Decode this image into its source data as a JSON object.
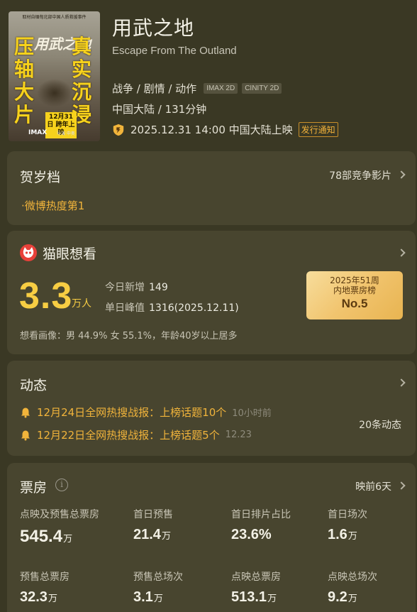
{
  "movie": {
    "title": "用武之地",
    "subtitle": "Escape From The Outland",
    "genres": "战争 / 剧情 / 动作",
    "tags": [
      "IMAX 2D",
      "CINITY 2D"
    ],
    "region_duration": "中国大陆 / 131分钟",
    "release": "2025.12.31 14:00 中国大陆上映",
    "notify_label": "发行通知",
    "poster": {
      "top_text": "取材自缅甸北部中国人质救援事件",
      "logo": "用武之地",
      "left_text": "压轴大片",
      "right_text": "真实沉浸",
      "date_text": "12月31日 跨年上映",
      "imax": "IMAX",
      "credit": "导演 申奥"
    }
  },
  "holiday": {
    "title": "贺岁档",
    "competitors": "78部竞争影片",
    "rank": "·微博热度第1"
  },
  "maoyan": {
    "title": "猫眼想看",
    "count": "3.3",
    "unit": "万人",
    "today_label": "今日新增",
    "today_value": "149",
    "peak_label": "单日峰值",
    "peak_value": "1316(2025.12.11)",
    "badge_line1": "2025年51周",
    "badge_line2": "内地票房榜",
    "badge_rank": "No.5",
    "portrait": "想看画像：男 44.9%  女 55.1%，年龄40岁以上居多"
  },
  "dynamics": {
    "title": "动态",
    "items": [
      {
        "text": "12月24日全网热搜战报：上榜话题10个",
        "time": "10小时前"
      },
      {
        "text": "12月22日全网热搜战报：上榜话题5个",
        "time": "12.23"
      }
    ],
    "count": "20条动态"
  },
  "boxoffice": {
    "title": "票房",
    "days_before": "映前6天",
    "stats": [
      {
        "label": "点映及预售总票房",
        "value": "545.4",
        "unit": "万"
      },
      {
        "label": "首日预售",
        "value": "21.4",
        "unit": "万"
      },
      {
        "label": "首日排片占比",
        "value": "23.6%",
        "unit": ""
      },
      {
        "label": "首日场次",
        "value": "1.6",
        "unit": "万"
      },
      {
        "label": "预售总票房",
        "value": "32.3",
        "unit": "万"
      },
      {
        "label": "预售总场次",
        "value": "3.1",
        "unit": "万"
      },
      {
        "label": "点映总票房",
        "value": "513.1",
        "unit": "万"
      },
      {
        "label": "点映总场次",
        "value": "9.2",
        "unit": "万"
      }
    ]
  },
  "colors": {
    "background": "#3a3824",
    "card": "#48452f",
    "accent": "#f7cd43",
    "highlight": "#f1b43b"
  }
}
